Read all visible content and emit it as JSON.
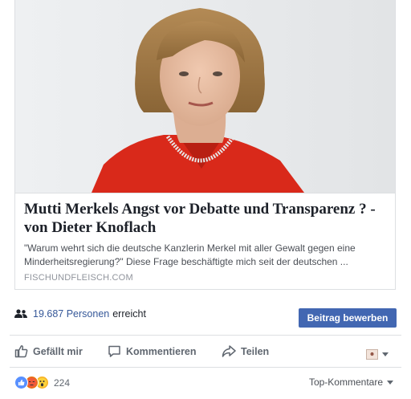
{
  "link_preview": {
    "headline": "Mutti Merkels Angst vor Debatte und Transparenz ? - von Dieter Knoflach",
    "description": "\"Warum wehrt sich die deutsche Kanzlerin Merkel mit aller Gewalt gegen eine Minderheitsregierung?\" Diese Frage beschäftigte mich seit der deutschen ...",
    "domain": "FISCHUNDFLEISCH.COM"
  },
  "insights": {
    "reach_number": "19.687",
    "reach_people_label": "Personen",
    "reach_suffix": "erreicht",
    "boost_button_label": "Beitrag bewerben"
  },
  "actions": {
    "like_label": "Gefällt mir",
    "comment_label": "Kommentieren",
    "share_label": "Teilen"
  },
  "reactions": {
    "count": "224",
    "types": [
      "like",
      "angry",
      "wow"
    ]
  },
  "comments_sort": {
    "label": "Top-Kommentare"
  },
  "colors": {
    "accent": "#4267b2",
    "link": "#365899",
    "jacket": "#d9291a"
  }
}
